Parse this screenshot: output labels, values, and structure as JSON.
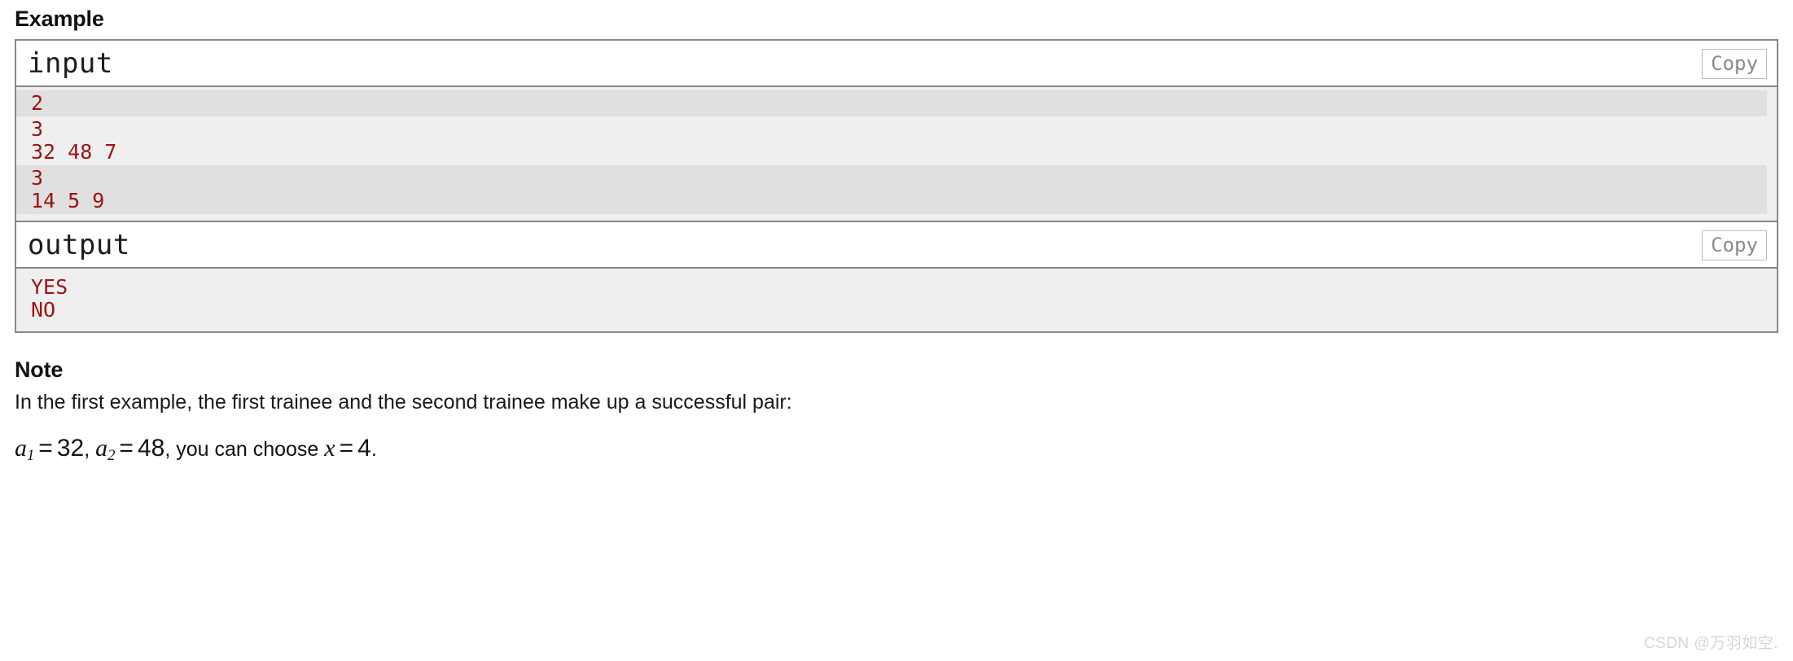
{
  "example": {
    "heading": "Example",
    "blocks": [
      {
        "label": "input",
        "copy_label": "Copy",
        "groups": [
          {
            "lines": [
              "2"
            ]
          },
          {
            "lines": [
              "3",
              "32 48 7"
            ]
          },
          {
            "lines": [
              "3",
              "14 5 9"
            ]
          }
        ]
      },
      {
        "label": "output",
        "copy_label": "Copy",
        "lines": [
          "YES",
          "NO"
        ]
      }
    ]
  },
  "note": {
    "heading": "Note",
    "paragraph": "In the first example, the first trainee and the second trainee make up a successful pair:",
    "formula": {
      "var1": "a",
      "sub1": "1",
      "eq1": "=",
      "val1": "32",
      "comma1": ",",
      "var2": "a",
      "sub2": "2",
      "eq2": "=",
      "val2": "48",
      "text_mid": ", you can choose",
      "var3": "x",
      "eq3": "=",
      "val3": "4",
      "period": "."
    },
    "formula_plain": "a1 = 32, a2 = 48, you can choose x = 4."
  },
  "watermark": "CSDN @万羽如空.",
  "colors": {
    "code_red": "#9b1414",
    "band_dark": "#e0e0e0",
    "band_light": "#efefef",
    "border_gray": "#888888",
    "copy_text": "#8a8a8a"
  }
}
